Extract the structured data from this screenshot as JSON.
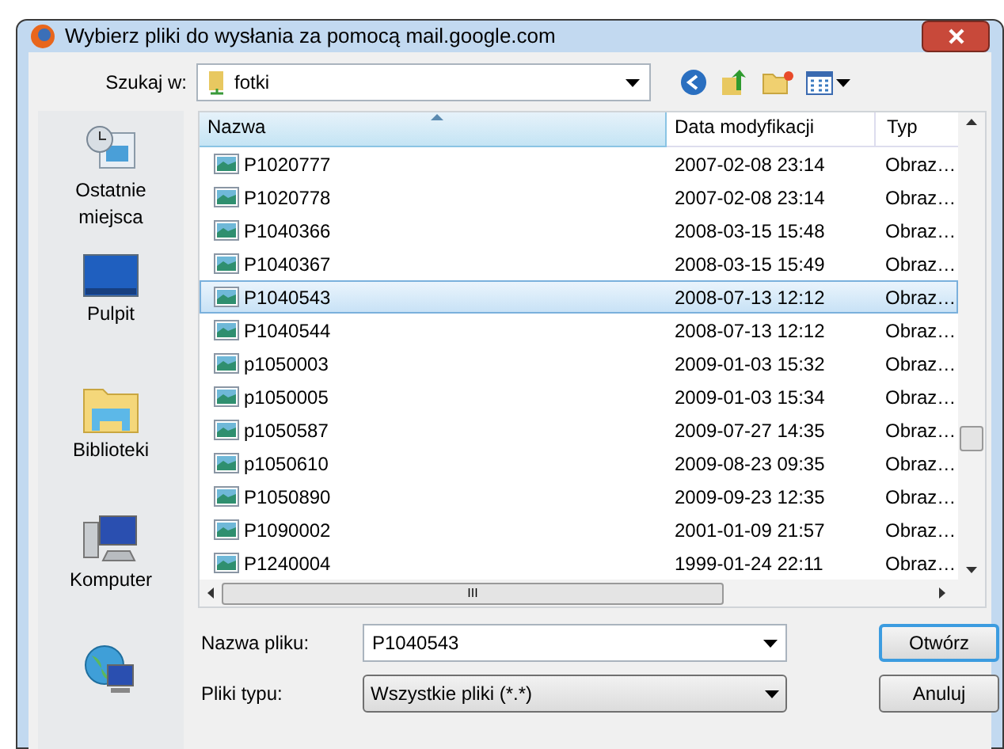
{
  "window": {
    "title": "Wybierz pliki do wysłania za pomocą mail.google.com"
  },
  "look_in": {
    "label": "Szukaj w:",
    "value": "fotki"
  },
  "places": [
    {
      "kind": "recent",
      "label": "Ostatnie miejsca"
    },
    {
      "kind": "desktop",
      "label": "Pulpit"
    },
    {
      "kind": "libraries",
      "label": "Biblioteki"
    },
    {
      "kind": "computer",
      "label": "Komputer"
    },
    {
      "kind": "network"
    }
  ],
  "table": {
    "columns": [
      "Nazwa",
      "Data modyfikacji",
      "Typ"
    ],
    "rows": [
      {
        "name": "P1020777",
        "date": "2007-02-08 23:14",
        "type": "Obraz…",
        "selected": false
      },
      {
        "name": "P1020778",
        "date": "2007-02-08 23:14",
        "type": "Obraz…",
        "selected": false
      },
      {
        "name": "P1040366",
        "date": "2008-03-15 15:48",
        "type": "Obraz…",
        "selected": false
      },
      {
        "name": "P1040367",
        "date": "2008-03-15 15:49",
        "type": "Obraz…",
        "selected": false
      },
      {
        "name": "P1040543",
        "date": "2008-07-13 12:12",
        "type": "Obraz…",
        "selected": true
      },
      {
        "name": "P1040544",
        "date": "2008-07-13 12:12",
        "type": "Obraz…",
        "selected": false
      },
      {
        "name": "p1050003",
        "date": "2009-01-03 15:32",
        "type": "Obraz…",
        "selected": false
      },
      {
        "name": "p1050005",
        "date": "2009-01-03 15:34",
        "type": "Obraz…",
        "selected": false
      },
      {
        "name": "p1050587",
        "date": "2009-07-27 14:35",
        "type": "Obraz…",
        "selected": false
      },
      {
        "name": "p1050610",
        "date": "2009-08-23 09:35",
        "type": "Obraz…",
        "selected": false
      },
      {
        "name": "P1050890",
        "date": "2009-09-23 12:35",
        "type": "Obraz…",
        "selected": false
      },
      {
        "name": "P1090002",
        "date": "2001-01-09 21:57",
        "type": "Obraz…",
        "selected": false
      },
      {
        "name": "P1240004",
        "date": "1999-01-24 22:11",
        "type": "Obraz…",
        "selected": false
      }
    ]
  },
  "hscroll_grip": "III",
  "filename": {
    "label": "Nazwa pliku:",
    "value": "P1040543"
  },
  "filetype": {
    "label": "Pliki typu:",
    "value": "Wszystkie pliki (*.*)"
  },
  "buttons": [
    "Otwórz",
    "Anuluj"
  ]
}
